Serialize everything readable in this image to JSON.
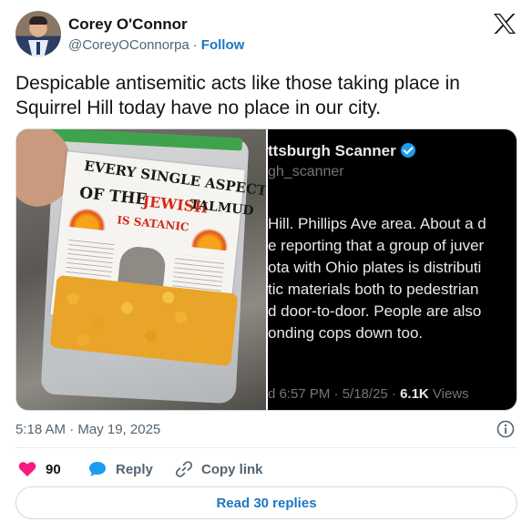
{
  "author": {
    "name": "Corey O'Connor",
    "handle": "@CoreyOConnorpa",
    "separator": "·",
    "follow_label": "Follow"
  },
  "tweet": {
    "text": "Despicable antisemitic acts like those taking place in Squirrel Hill today have no place in our city.",
    "timestamp": "5:18 AM · May 19, 2025"
  },
  "media": {
    "left_photo": {
      "flyer_lines": [
        "EVERY SINGLE ASPECT",
        "OF THE",
        "JEWISH",
        "TALMUD",
        "IS SATANIC"
      ]
    },
    "right_screenshot": {
      "name": "ttsburgh Scanner",
      "handle": "gh_scanner",
      "body_lines": [
        "Hill. Phillips Ave area.  About a d",
        "e reporting that a group of juver",
        "ota with Ohio plates is distributi",
        "tic materials both to pedestrian",
        "d door-to-door. People are also",
        "onding cops down too."
      ],
      "meta_time": "d 6:57 PM · 5/18/25 · ",
      "meta_views": "6.1K",
      "meta_views_label": " Views",
      "verified_color": "#1d9bf0"
    }
  },
  "actions": {
    "like_count": "90",
    "reply_label": "Reply",
    "copy_label": "Copy link"
  },
  "read_replies_label": "Read 30 replies",
  "colors": {
    "accent": "#1d77c2",
    "like": "#f91880",
    "reply_icon": "#1d9bf0",
    "secondary_text": "#536471"
  },
  "icons": {
    "brand": "x-logo-icon",
    "like": "heart-icon",
    "reply": "speech-bubble-icon",
    "copy": "link-icon",
    "info": "info-icon"
  }
}
